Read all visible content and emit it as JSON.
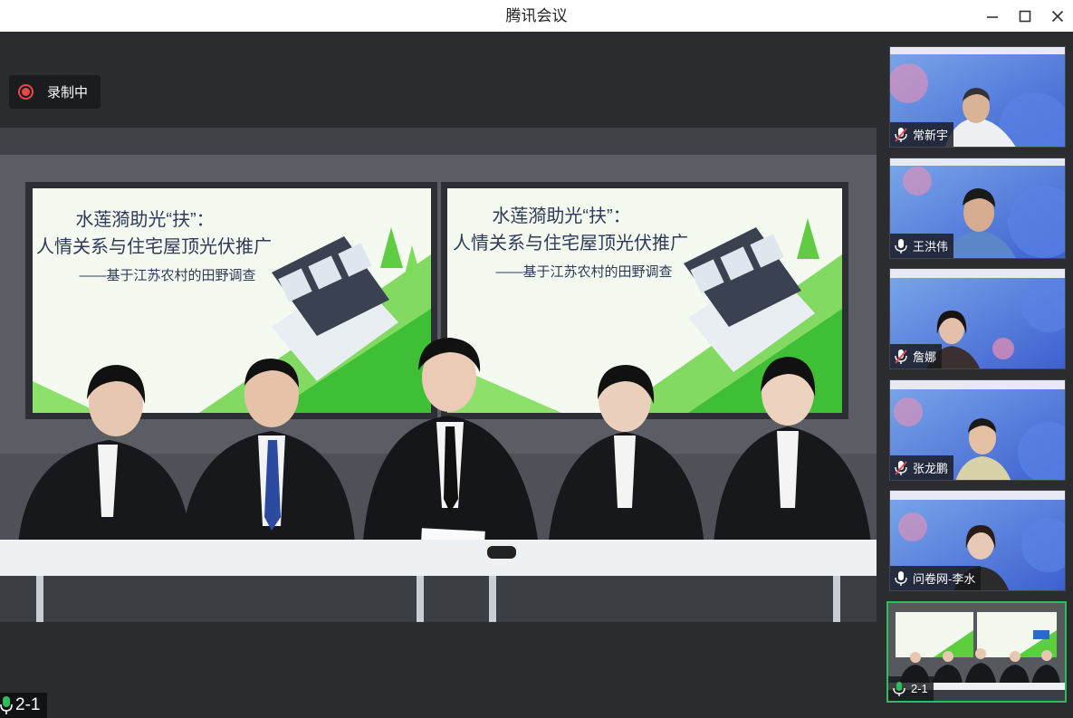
{
  "window": {
    "title": "腾讯会议"
  },
  "recording": {
    "label": "录制中"
  },
  "stage": {
    "speaker_label": "2-1",
    "slides": [
      {
        "line1": "水莲漪助光“扶”：",
        "line2": "人情关系与住宅屋顶光伏推广",
        "line3": "——基于江苏农村的田野调查"
      },
      {
        "line1": "水莲漪助光“扶”：",
        "line2": "人情关系与住宅屋顶光伏推广",
        "line3": "——基于江苏农村的田野调查"
      }
    ]
  },
  "participants": [
    {
      "name": "常新宇",
      "mic": "muted"
    },
    {
      "name": "王洪伟",
      "mic": "on"
    },
    {
      "name": "詹娜",
      "mic": "muted"
    },
    {
      "name": "张龙鹏",
      "mic": "muted"
    },
    {
      "name": "问卷网-李水",
      "mic": "on"
    },
    {
      "name": "2-1",
      "mic": "speaking"
    }
  ],
  "colors": {
    "accent": "#2ebd5a",
    "record": "#e8484b",
    "slide_green": "#5ccf3c"
  }
}
